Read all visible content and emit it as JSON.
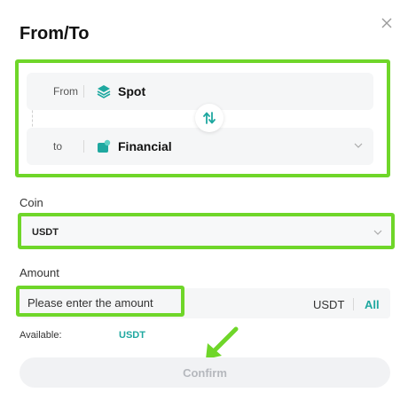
{
  "dialog": {
    "title": "From/To"
  },
  "transfer": {
    "from": {
      "label": "From",
      "account": "Spot",
      "icon": "spot-account-icon"
    },
    "to": {
      "label": "to",
      "account": "Financial",
      "icon": "financial-account-icon"
    },
    "swap_icon": "swap-arrows-icon"
  },
  "coin": {
    "label": "Coin",
    "selected": "USDT"
  },
  "amount": {
    "label": "Amount",
    "placeholder": "Please enter the amount",
    "unit": "USDT",
    "all_label": "All"
  },
  "available": {
    "label": "Available:",
    "unit": "USDT"
  },
  "confirm_label": "Confirm",
  "colors": {
    "accent": "#1fa8a0",
    "highlight": "#6fd629",
    "from_dot": "#1fa8a0",
    "to_dot": "#f0922e",
    "disabled_text": "#b5b8bd"
  }
}
